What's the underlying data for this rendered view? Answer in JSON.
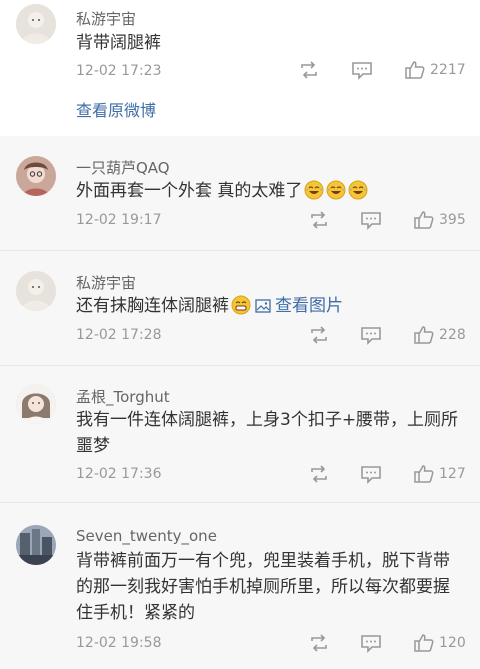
{
  "comments": [
    {
      "user": "私游宇宙",
      "text": "背带阔腿裤",
      "time": "12-02 17:23",
      "likes": "2217",
      "view_original": "查看原微博"
    },
    {
      "user": "一只葫芦QAQ",
      "text": "外面再套一个外套 真的太难了",
      "emoji": "laughing-tears-emoji",
      "time": "12-02 19:17",
      "likes": "395"
    },
    {
      "user": "私游宇宙",
      "text": "还有抹胸连体阔腿裤",
      "emoji": "grin-emoji",
      "image_link": "查看图片",
      "time": "12-02 17:28",
      "likes": "228"
    },
    {
      "user": "孟根_Torghut",
      "text": "我有一件连体阔腿裤，上身3个扣子+腰带，上厕所噩梦",
      "time": "12-02 17:36",
      "likes": "127"
    },
    {
      "user": "Seven_twenty_one",
      "text": "背带裤前面万一有个兜，兜里装着手机，脱下背带的那一刻我好害怕手机掉厕所里，所以每次都要握住手机！紧紧的",
      "time": "12-02 19:58",
      "likes": "120"
    }
  ],
  "colors": {
    "link": "#3e6da7",
    "muted": "#999999",
    "list_bg": "#f7f7f7"
  },
  "icons": [
    "repost-icon",
    "comment-icon",
    "like-icon",
    "image-icon"
  ]
}
